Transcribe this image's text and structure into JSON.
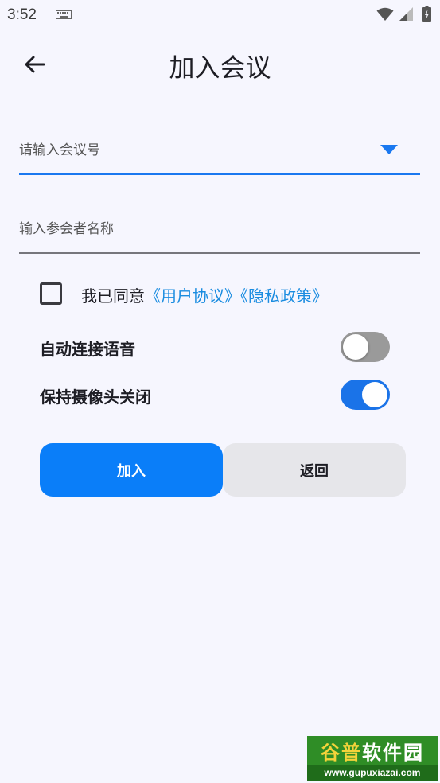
{
  "status_bar": {
    "time": "3:52"
  },
  "header": {
    "title": "加入会议"
  },
  "meeting_field": {
    "placeholder": "请输入会议号"
  },
  "name_field": {
    "placeholder": "输入参会者名称"
  },
  "agreement": {
    "prefix": "我已同意",
    "user_agreement": "《用户协议》",
    "privacy_policy": "《隐私政策》",
    "checked": false
  },
  "options": [
    {
      "label": "自动连接语音",
      "enabled": false
    },
    {
      "label": "保持摄像头关闭",
      "enabled": true
    }
  ],
  "buttons": {
    "join": "加入",
    "back": "返回"
  },
  "watermark": {
    "highlight": "谷普",
    "title_rest": "软件园",
    "url": "www.gupuxiazai.com"
  },
  "colors": {
    "accent": "#1a78f0",
    "join_button": "#0a7ef9",
    "link": "#1a8ce0",
    "background": "#f6f6fe"
  }
}
